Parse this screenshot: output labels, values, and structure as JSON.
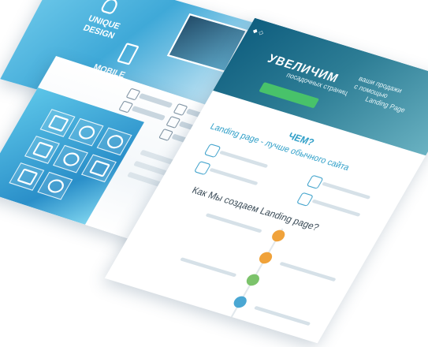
{
  "back_sheet": {
    "label_design": "UNIQUE DESIGN",
    "label_mobile": "MOBILE SUPPORT"
  },
  "front_sheet": {
    "banner_title": "УВЕЛИЧИМ",
    "banner_line1": "ваши продажи",
    "banner_line2": "с помощью",
    "banner_line3": "посадочных страниц",
    "banner_line4": "Landing Page",
    "heading_chem": "ЧЕМ?",
    "heading_landing": "Landing page - лучше обычного сайта",
    "heading_how": "Как Мы создаем Landing page?"
  },
  "colors": {
    "accent_blue": "#2f9fc8",
    "banner_teal": "#0f5e7f",
    "cta_green": "#48c26a",
    "step_orange": "#f0a23a",
    "step_green": "#7cc36b",
    "step_blue": "#4aa7d3"
  },
  "icons": [
    "bulb-icon",
    "phone-icon",
    "chart-icon",
    "settings-icon",
    "globe-icon",
    "tools-icon",
    "network-icon"
  ]
}
